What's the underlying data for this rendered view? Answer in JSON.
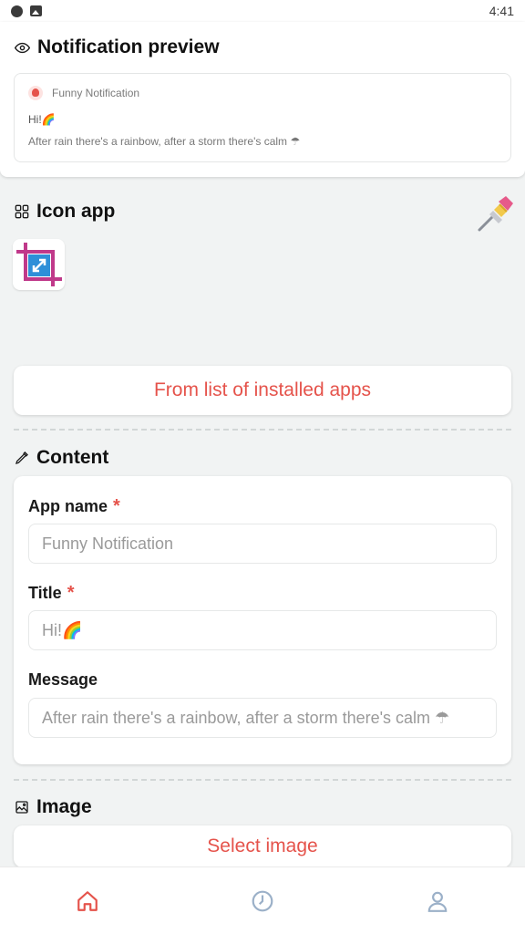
{
  "status_bar": {
    "time": "4:41"
  },
  "preview": {
    "heading": "Notification preview",
    "app_name": "Funny Notification",
    "title": "Hi!🌈",
    "message": "After rain there's a rainbow, after a storm there's calm ☂"
  },
  "icon_section": {
    "heading": "Icon app",
    "installed_button": "From list of installed apps"
  },
  "content": {
    "heading": "Content",
    "app_name_label": "App name",
    "app_name_value": "Funny Notification",
    "title_label": "Title",
    "title_value": "Hi!🌈",
    "message_label": "Message",
    "message_value": "After rain there's a rainbow, after a storm there's calm ☂",
    "required_mark": "*"
  },
  "image_section": {
    "heading": "Image",
    "select_button": "Select image"
  },
  "colors": {
    "accent": "#e5534b",
    "nav_inactive": "#9bb0c8"
  },
  "bottom_nav": {
    "items": [
      "home-icon",
      "history-icon",
      "profile-icon"
    ],
    "active": "home-icon"
  }
}
